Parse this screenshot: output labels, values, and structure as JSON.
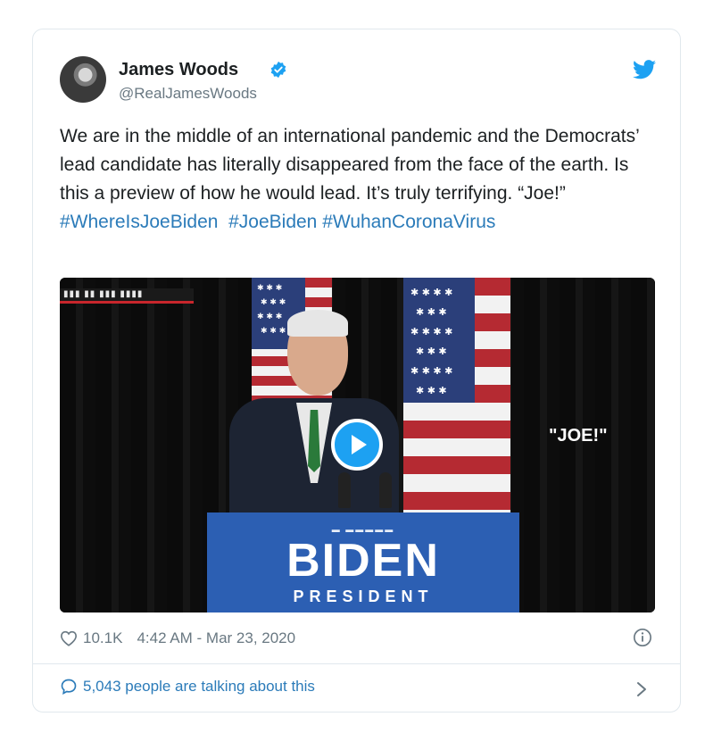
{
  "tweet": {
    "author_name": "James Woods",
    "author_handle": "@RealJamesWoods",
    "text_plain": "We are in the middle of an international pandemic and the Democrats’ lead candidate has literally disappeared from the face of the earth. Is this a preview of how he would lead. It’s truly terrifying. “Joe!”",
    "hashtags": [
      "#WhereIsJoeBiden",
      "#JoeBiden",
      "#WuhanCoronaVirus"
    ],
    "likes": "10.1K",
    "timestamp": "4:42 AM - Mar 23, 2020",
    "talking": "5,043 people are talking about this"
  },
  "video": {
    "overlay_text": "\"JOE!\"",
    "podium_name": "BIDEN",
    "podium_title": "PRESIDENT"
  },
  "icons": {
    "verified": "verified-badge-icon",
    "bird": "twitter-bird-icon",
    "heart": "heart-icon",
    "info": "info-icon",
    "bubble": "speech-bubble-icon",
    "chevron": "chevron-right-icon",
    "play": "play-icon"
  },
  "colors": {
    "link": "#2b7bb9",
    "brand": "#1da1f2",
    "muted": "#697882",
    "podium": "#2c5fb3",
    "podium_accent": "#e0452b"
  }
}
